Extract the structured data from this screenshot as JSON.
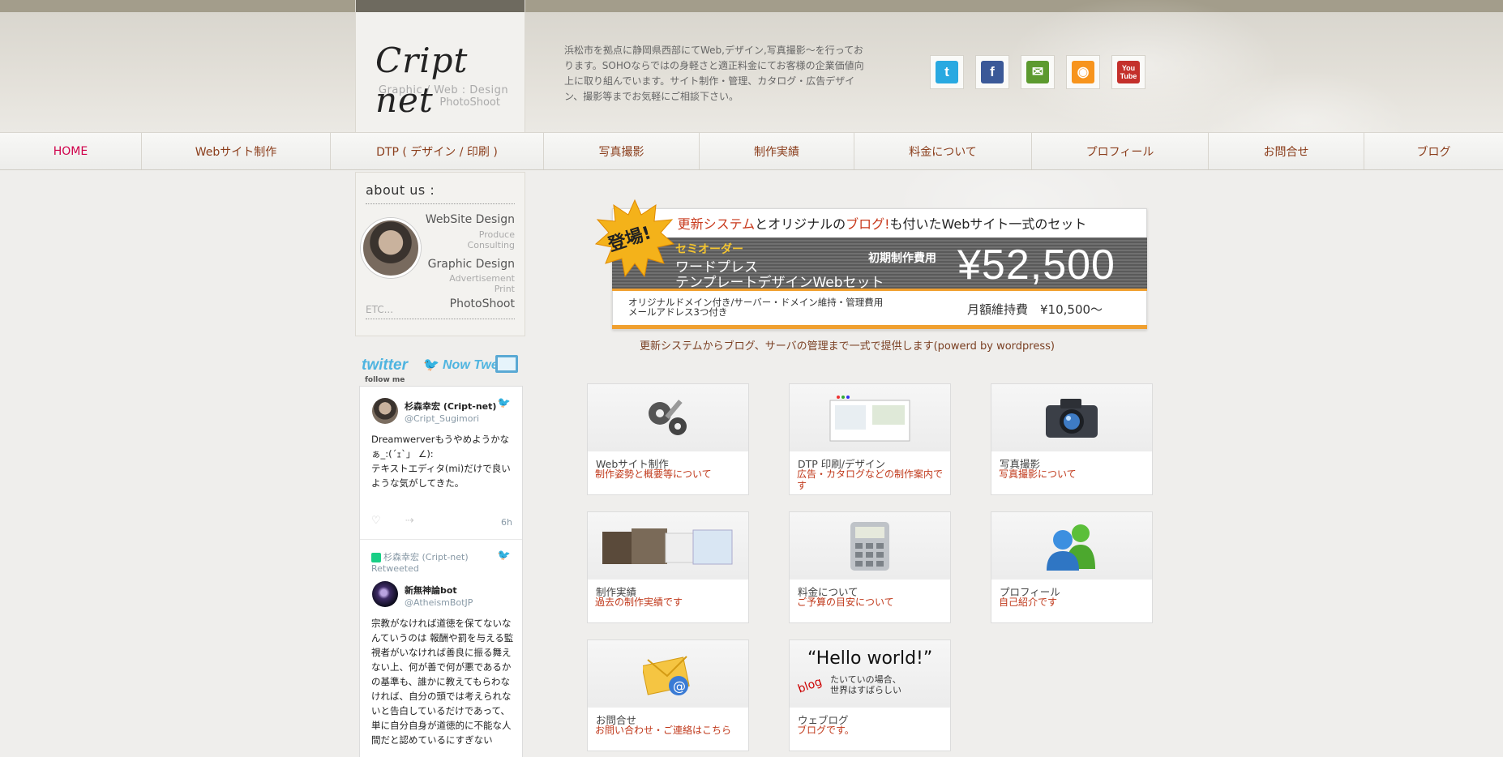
{
  "header": {
    "logo_text": "Cript net",
    "logo_sub1": "Graphic / Web : Design",
    "logo_sub2": "PhotoShoot",
    "intro": "浜松市を拠点に静岡県西部にてWeb,デザイン,写真撮影〜を行っております。SOHOならではの身軽さと適正料金にてお客様の企業価値向上に取り組んでいます。サイト制作・管理、カタログ・広告デザイン、撮影等までお気軽にご相談下さい。",
    "social": [
      {
        "name": "twitter",
        "glyph": "t",
        "color": "#29a9e1"
      },
      {
        "name": "facebook",
        "glyph": "f",
        "color": "#3b5998"
      },
      {
        "name": "mail",
        "glyph": "✉",
        "color": "#5c9a2f"
      },
      {
        "name": "rss",
        "glyph": "◉",
        "color": "#f7941d"
      },
      {
        "name": "youtube",
        "glyph": "You Tube",
        "color": "#c4302b"
      }
    ]
  },
  "nav": {
    "items": [
      {
        "label": "HOME",
        "active": true
      },
      {
        "label": "Webサイト制作"
      },
      {
        "label": "DTP ( デザイン / 印刷 )"
      },
      {
        "label": "写真撮影"
      },
      {
        "label": "制作実績"
      },
      {
        "label": "料金について"
      },
      {
        "label": "プロフィール"
      },
      {
        "label": "お問合せ"
      },
      {
        "label": "ブログ"
      }
    ]
  },
  "about": {
    "title": "about us :",
    "website_design": "WebSite Design",
    "produce": "Produce",
    "consulting": "Consulting",
    "graphic_design": "Graphic Design",
    "advertisement": "Advertisement",
    "print": "Print",
    "photoshoot": "PhotoShoot",
    "etc": "ETC..."
  },
  "twitter_widget": {
    "logo": "twitter",
    "now_tweet": "Now Tweet",
    "follow_me": "follow me",
    "tweets": [
      {
        "name": "杉森幸宏 (Cript-net)",
        "handle": "@Cript_Sugimori",
        "body": "Dreamwerverもうやめようかなぁ_:(´ｪ`」 ∠):\nテキストエディタ(mi)だけで良いような気がしてきた。",
        "time": "6h"
      },
      {
        "retweeted_by": "杉森幸宏 (Cript-net)",
        "retweeted_label": "Retweeted",
        "name": "新無神論bot",
        "handle": "@AtheismBotJP",
        "body": "宗教がなければ道徳を保てないなんていうのは 報酬や罰を与える監視者がいなければ善良に振る舞えない上、何が善で何が悪であるかの基準も、誰かに教えてもらわなければ、自分の頭では考えられないと告白しているだけであって、単に自分自身が道徳的に不能な人間だと認めているにすぎない"
      }
    ]
  },
  "banner": {
    "badge": "登場!",
    "headline_part1": "更新システム",
    "headline_part2": "とオリジナルの",
    "headline_part3": "ブログ!",
    "headline_part4": "も付いたWebサイト一式のセット",
    "semi_order": "セミオーダー",
    "line1": "ワードプレス",
    "line2": "テンプレートデザインWebセット",
    "initial_fee_label": "初期制作費用",
    "price": "¥52,500",
    "includes1": "オリジナルドメイン付き/サーバー・ドメイン維持・管理費用",
    "includes2": "メールアドレス3つ付き",
    "monthly": "月額維持費　¥10,500〜"
  },
  "tagline": "更新システムからブログ、サーバの管理まで一式で提供します(powerd by wordpress)",
  "cards": [
    {
      "icon": "tools-icon",
      "title": "Webサイト制作",
      "desc": "制作姿勢と概要等について"
    },
    {
      "icon": "dtp-icon",
      "title": "DTP 印刷/デザイン",
      "desc": "広告・カタログなどの制作案内です"
    },
    {
      "icon": "camera-icon",
      "title": "写真撮影",
      "desc": "写真撮影について"
    },
    {
      "icon": "websites-icon",
      "title": "制作実績",
      "desc": "過去の制作実績です"
    },
    {
      "icon": "calculator-icon",
      "title": "料金について",
      "desc": "ご予算の目安について"
    },
    {
      "icon": "users-icon",
      "title": "プロフィール",
      "desc": "自己紹介です"
    },
    {
      "icon": "mail-icon",
      "title": "お問合せ",
      "desc": "お問い合わせ・ご連絡はこちら"
    },
    {
      "icon": "blog-icon",
      "title": "ウェブログ",
      "desc": "ブログです。",
      "img_text1": "“Hello world!”",
      "img_text2": "たいていの場合、",
      "img_text3": "世界はすばらしい",
      "img_tag": "blog"
    }
  ],
  "colors": {
    "accent_red": "#c0391b",
    "nav_text": "#8b3e1c",
    "nav_active": "#d0004a",
    "banner_orange": "#f0a030"
  }
}
